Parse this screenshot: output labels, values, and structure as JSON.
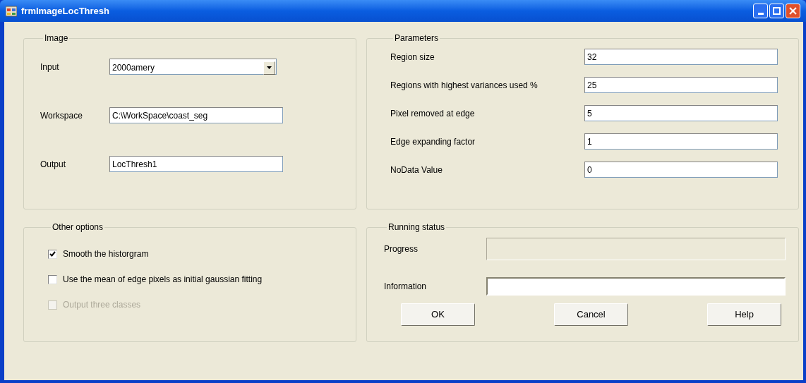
{
  "window": {
    "title": "frmImageLocThresh"
  },
  "image_group": {
    "title": "Image",
    "fields": [
      {
        "kind": "combo",
        "label": "Input",
        "value": "2000amery"
      },
      {
        "kind": "text",
        "label": "Workspace",
        "value": "C:\\WorkSpace\\coast_seg"
      },
      {
        "kind": "text",
        "label": "Output",
        "value": "LocThresh1"
      }
    ]
  },
  "parameters": {
    "title": "Parameters",
    "fields": [
      {
        "label": "Region size",
        "value": "32"
      },
      {
        "label": "Regions with highest variances used %",
        "value": "25"
      },
      {
        "label": "Pixel removed at edge",
        "value": "5"
      },
      {
        "label": "Edge expanding factor",
        "value": "1"
      },
      {
        "label": "NoData Value",
        "value": "0"
      }
    ]
  },
  "other_options": {
    "title": "Other options",
    "options": [
      {
        "label": "Smooth the historgram",
        "checked": true,
        "disabled": false
      },
      {
        "label": "Use the mean of edge pixels as initial gaussian fitting",
        "checked": false,
        "disabled": false
      },
      {
        "label": "Output three classes",
        "checked": false,
        "disabled": true
      }
    ]
  },
  "running_status": {
    "title": "Running status",
    "progress": {
      "label": "Progress",
      "level": 0
    },
    "information": {
      "label": "Information"
    },
    "buttons": [
      "OK",
      "Cancel",
      "Help"
    ]
  }
}
